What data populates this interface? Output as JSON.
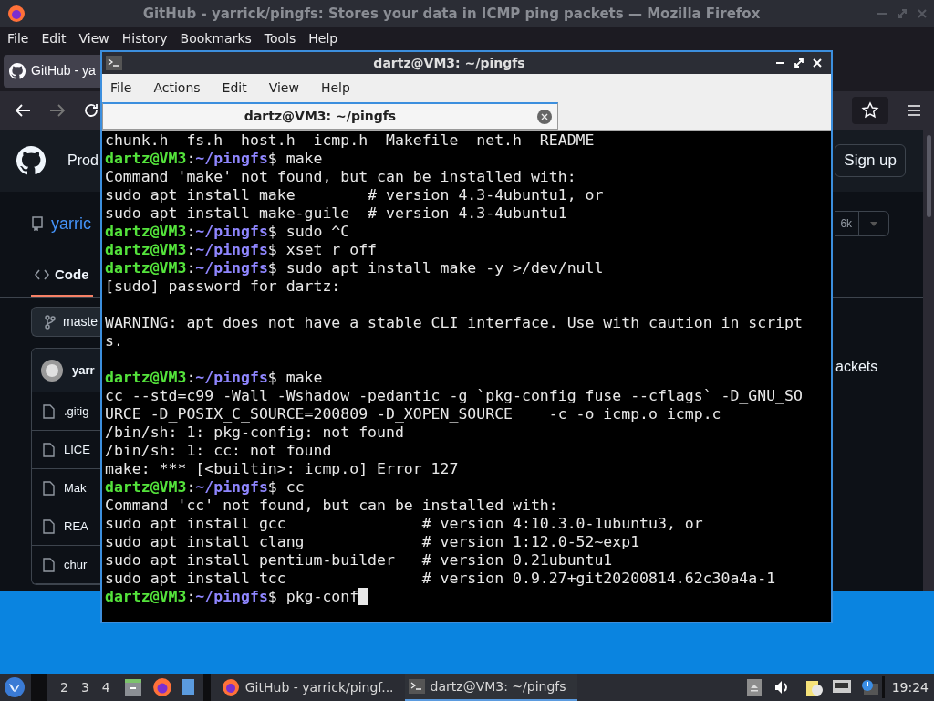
{
  "browser": {
    "title": "GitHub - yarrick/pingfs: Stores your data in ICMP ping packets — Mozilla Firefox",
    "menu": [
      "File",
      "Edit",
      "View",
      "History",
      "Bookmarks",
      "Tools",
      "Help"
    ],
    "tab": {
      "title": "GitHub - ya"
    },
    "page": {
      "nav_text": "Prod",
      "sign_up": "Sign up",
      "repo_owner": "yarric",
      "star_count": "6k",
      "tabs": [
        {
          "label": "Code",
          "selected": true
        }
      ],
      "branch": "maste",
      "description": "ackets",
      "commit_author": "yarr",
      "files": [
        ".gitig",
        "LICE",
        "Mak",
        "REA",
        "chur"
      ]
    }
  },
  "terminal": {
    "title": "dartz@VM3: ~/pingfs",
    "menu": [
      "File",
      "Actions",
      "Edit",
      "View",
      "Help"
    ],
    "tab": {
      "title": "dartz@VM3: ~/pingfs"
    },
    "lines": [
      {
        "kind": "output",
        "text": "chunk.h  fs.h  host.h  icmp.h  Makefile  net.h  README"
      },
      {
        "kind": "prompt",
        "user": "dartz@VM3",
        "sep": ":",
        "path": "~/pingfs",
        "command": "$ make",
        "cursor": false
      },
      {
        "kind": "output",
        "text": "Command 'make' not found, but can be installed with:"
      },
      {
        "kind": "output",
        "text": "sudo apt install make        # version 4.3-4ubuntu1, or"
      },
      {
        "kind": "output",
        "text": "sudo apt install make-guile  # version 4.3-4ubuntu1"
      },
      {
        "kind": "prompt",
        "user": "dartz@VM3",
        "sep": ":",
        "path": "~/pingfs",
        "command": "$ sudo ^C",
        "cursor": false
      },
      {
        "kind": "prompt",
        "user": "dartz@VM3",
        "sep": ":",
        "path": "~/pingfs",
        "command": "$ xset r off",
        "cursor": false
      },
      {
        "kind": "prompt",
        "user": "dartz@VM3",
        "sep": ":",
        "path": "~/pingfs",
        "command": "$ sudo apt install make -y >/dev/null",
        "cursor": false
      },
      {
        "kind": "output",
        "text": "[sudo] password for dartz:"
      },
      {
        "kind": "blank"
      },
      {
        "kind": "output",
        "text": "WARNING: apt does not have a stable CLI interface. Use with caution in script"
      },
      {
        "kind": "output",
        "text": "s."
      },
      {
        "kind": "blank"
      },
      {
        "kind": "prompt",
        "user": "dartz@VM3",
        "sep": ":",
        "path": "~/pingfs",
        "command": "$ make",
        "cursor": false
      },
      {
        "kind": "output",
        "text": "cc --std=c99 -Wall -Wshadow -pedantic -g `pkg-config fuse --cflags` -D_GNU_SO"
      },
      {
        "kind": "output",
        "text": "URCE -D_POSIX_C_SOURCE=200809 -D_XOPEN_SOURCE    -c -o icmp.o icmp.c"
      },
      {
        "kind": "output",
        "text": "/bin/sh: 1: pkg-config: not found"
      },
      {
        "kind": "output",
        "text": "/bin/sh: 1: cc: not found"
      },
      {
        "kind": "output",
        "text": "make: *** [<builtin>: icmp.o] Error 127"
      },
      {
        "kind": "prompt",
        "user": "dartz@VM3",
        "sep": ":",
        "path": "~/pingfs",
        "command": "$ cc",
        "cursor": false
      },
      {
        "kind": "output",
        "text": "Command 'cc' not found, but can be installed with:"
      },
      {
        "kind": "output",
        "text": "sudo apt install gcc               # version 4:10.3.0-1ubuntu3, or"
      },
      {
        "kind": "output",
        "text": "sudo apt install clang             # version 1:12.0-52~exp1"
      },
      {
        "kind": "output",
        "text": "sudo apt install pentium-builder   # version 0.21ubuntu1"
      },
      {
        "kind": "output",
        "text": "sudo apt install tcc               # version 0.9.27+git20200814.62c30a4a-1"
      },
      {
        "kind": "prompt",
        "user": "dartz@VM3",
        "sep": ":",
        "path": "~/pingfs",
        "command": "$ pkg-conf",
        "cursor": true
      }
    ]
  },
  "taskbar": {
    "workspaces": [
      "2",
      "3",
      "4"
    ],
    "tasks": [
      {
        "kind": "browser",
        "title": "GitHub - yarrick/pingf...",
        "active": false
      },
      {
        "kind": "terminal",
        "title": "dartz@VM3: ~/pingfs",
        "active": true
      }
    ],
    "clock": "19:24"
  }
}
